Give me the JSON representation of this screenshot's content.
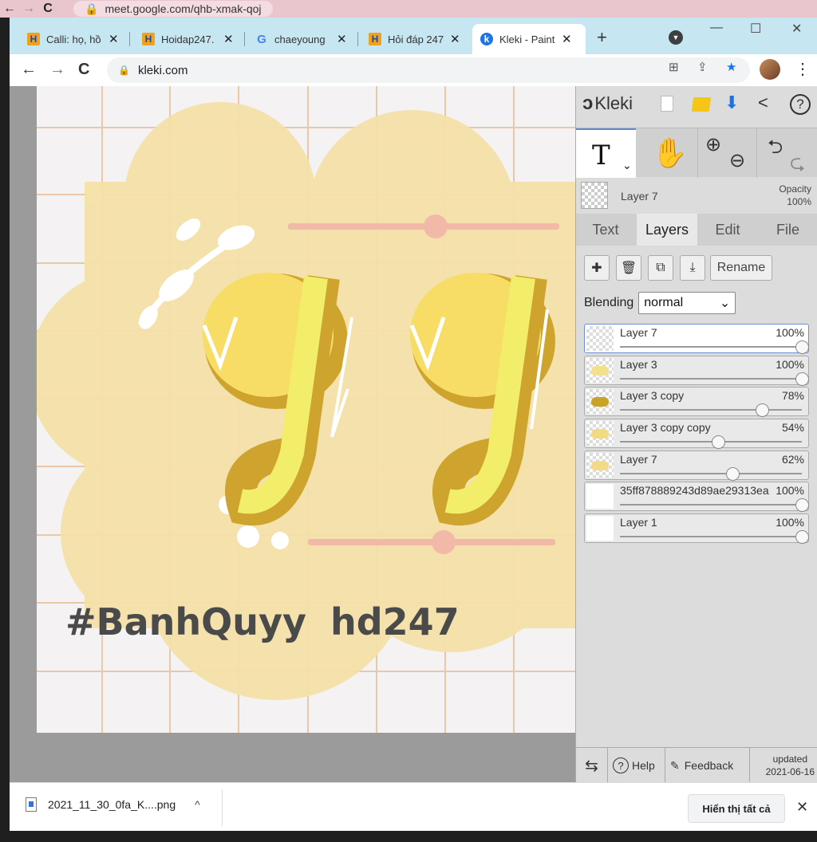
{
  "outer_window": {
    "url": "meet.google.com/qhb-xmak-qoj",
    "back": "←",
    "forward": "→",
    "reload": "C"
  },
  "browser": {
    "tabs": [
      {
        "label": "Calli: họ, hồ",
        "close": "✕",
        "icon": "hoidap-favicon"
      },
      {
        "label": "Hoidap247.",
        "close": "✕",
        "icon": "hoidap-favicon"
      },
      {
        "label": "chaeyoung",
        "close": "✕",
        "icon": "google-favicon"
      },
      {
        "label": "Hỏi đáp 247",
        "close": "✕",
        "icon": "hoidap-favicon"
      },
      {
        "label": "Kleki - Paint",
        "close": "✕",
        "icon": "kleki-favicon"
      }
    ],
    "new_tab": "+",
    "window_controls": {
      "minimize": "—",
      "maximize": "☐",
      "close": "✕"
    },
    "toolbar": {
      "back": "←",
      "forward": "→",
      "reload": "C"
    },
    "address": "kleki.com",
    "omnibox_icons": [
      "translate-icon",
      "share-icon",
      "bookmark-star-icon"
    ],
    "menu": "⋮"
  },
  "canvas": {
    "tags": [
      "#BanhQuyy",
      "hd247"
    ],
    "bg_color": "#f4f2f3",
    "cloud_color": "#f5e1a8",
    "accent_pink": "#f2b8a8",
    "letter_yellow": "#f7dd66"
  },
  "kleki": {
    "logo": "Kleki",
    "header_icons": [
      "new-image-icon",
      "open-folder-icon",
      "download-icon",
      "share-icon",
      "help-icon"
    ],
    "help": "?",
    "tools": {
      "text": "T",
      "caret": "⌄",
      "hand": "✋",
      "zoom_in": "⊕",
      "zoom_out": "⊖",
      "undo": "⮌",
      "redo": "⮎"
    },
    "current_layer": {
      "name": "Layer 7",
      "opacity_label": "Opacity",
      "opacity_value": "100%"
    },
    "tabs": [
      "Text",
      "Layers",
      "Edit",
      "File"
    ],
    "active_tab": "Layers",
    "layer_buttons": {
      "add": "✚",
      "delete": "🗑",
      "duplicate": "⧉",
      "merge": "⤓",
      "rename": "Rename"
    },
    "blending_label": "Blending",
    "blending_value": "normal",
    "layers": [
      {
        "name": "Layer 7",
        "opacity": "100%",
        "value": 1.0,
        "selected": true,
        "thumb": "transparent"
      },
      {
        "name": "Layer 3",
        "opacity": "100%",
        "value": 1.0,
        "selected": false,
        "thumb": "#f3e08a"
      },
      {
        "name": "Layer 3 copy",
        "opacity": "78%",
        "value": 0.78,
        "selected": false,
        "thumb": "#c9a227"
      },
      {
        "name": "Layer 3 copy copy",
        "opacity": "54%",
        "value": 0.54,
        "selected": false,
        "thumb": "#f1db82"
      },
      {
        "name": "Layer 7",
        "opacity": "62%",
        "value": 0.62,
        "selected": false,
        "thumb": "#f3d988"
      },
      {
        "name": "35ff878889243d89ae29313ea",
        "opacity": "100%",
        "value": 1.0,
        "selected": false,
        "thumb": "#ffffff"
      },
      {
        "name": "Layer 1",
        "opacity": "100%",
        "value": 1.0,
        "selected": false,
        "thumb": "#ffffff"
      }
    ],
    "footer": {
      "swap": "⇆",
      "help": "Help",
      "feedback": "Feedback",
      "updated_label": "updated",
      "updated_date": "2021-06-16"
    }
  },
  "downloads": {
    "file": "2021_11_30_0fa_K....png",
    "caret": "^",
    "show_all": "Hiển thị tất cả",
    "close": "✕"
  }
}
